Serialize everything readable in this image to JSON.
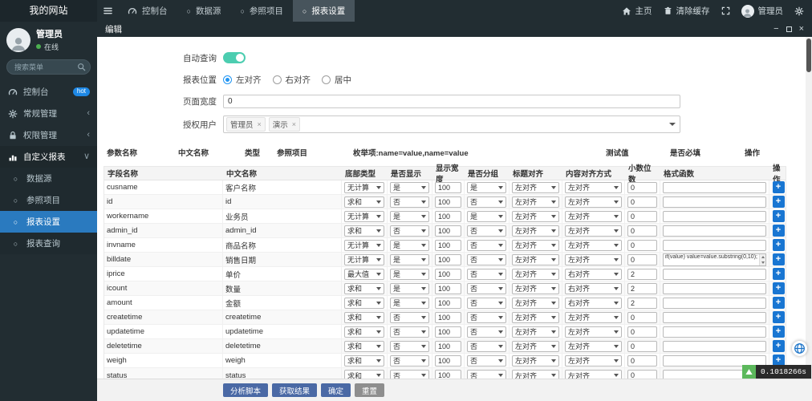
{
  "app": {
    "title": "我的网站"
  },
  "sidebar": {
    "user": {
      "name": "管理员",
      "status": "在线"
    },
    "search_placeholder": "搜索菜单",
    "menu": [
      {
        "id": "console",
        "label": "控制台",
        "icon": "dashboard-icon",
        "badge": "hot"
      },
      {
        "id": "general",
        "label": "常规管理",
        "icon": "gear-icon",
        "chevron": "left"
      },
      {
        "id": "auth",
        "label": "权限管理",
        "icon": "lock-icon",
        "chevron": "left"
      },
      {
        "id": "custom-report",
        "label": "自定义报表",
        "icon": "report-icon",
        "chevron": "down",
        "expanded": true,
        "children": [
          {
            "id": "datasource",
            "label": "数据源"
          },
          {
            "id": "reference",
            "label": "参照项目"
          },
          {
            "id": "report-setting",
            "label": "报表设置",
            "active": true
          },
          {
            "id": "report-query",
            "label": "报表查询"
          }
        ]
      }
    ]
  },
  "navbar": {
    "tabs": [
      {
        "id": "console",
        "label": "控制台",
        "icon": "dashboard-icon"
      },
      {
        "id": "datasource",
        "label": "数据源",
        "icon": "circle-icon"
      },
      {
        "id": "reference",
        "label": "参照项目",
        "icon": "circle-icon"
      },
      {
        "id": "report-setting",
        "label": "报表设置",
        "icon": "circle-icon",
        "active": true
      }
    ],
    "home": "主页",
    "clear_cache": "清除缓存",
    "user": "管理员"
  },
  "dialog": {
    "title": "编辑",
    "form": {
      "auto_query": {
        "label": "自动查询",
        "enabled": true
      },
      "position": {
        "label": "报表位置",
        "options": [
          "左对齐",
          "右对齐",
          "居中"
        ],
        "selected": "左对齐"
      },
      "page_width": {
        "label": "页面宽度",
        "value": "0"
      },
      "auth_users": {
        "label": "授权用户",
        "tags": [
          "管理员",
          "演示"
        ]
      }
    },
    "param_headers": [
      "参数名称",
      "中文名称",
      "类型",
      "参照项目",
      "枚举项:name=value,name=value",
      "测试值",
      "是否必填",
      "操作"
    ],
    "field_table": {
      "headers": [
        "字段名称",
        "中文名称",
        "底部类型",
        "是否显示",
        "显示宽度",
        "是否分组",
        "标题对齐",
        "内容对齐方式",
        "小数位数",
        "格式函数",
        "操作"
      ],
      "rows": [
        {
          "field": "cusname",
          "name": "客户名称",
          "calc": "无计算",
          "show": "是",
          "width": "100",
          "group": "是",
          "title_align": "左对齐",
          "content_align": "左对齐",
          "decimals": "0",
          "formatter": ""
        },
        {
          "field": "id",
          "name": "id",
          "calc": "求和",
          "show": "否",
          "width": "100",
          "group": "否",
          "title_align": "左对齐",
          "content_align": "左对齐",
          "decimals": "0",
          "formatter": ""
        },
        {
          "field": "workername",
          "name": "业务员",
          "calc": "无计算",
          "show": "是",
          "width": "100",
          "group": "是",
          "title_align": "左对齐",
          "content_align": "左对齐",
          "decimals": "0",
          "formatter": ""
        },
        {
          "field": "admin_id",
          "name": "admin_id",
          "calc": "求和",
          "show": "否",
          "width": "100",
          "group": "否",
          "title_align": "左对齐",
          "content_align": "左对齐",
          "decimals": "0",
          "formatter": ""
        },
        {
          "field": "invname",
          "name": "商品名称",
          "calc": "无计算",
          "show": "是",
          "width": "100",
          "group": "否",
          "title_align": "左对齐",
          "content_align": "左对齐",
          "decimals": "0",
          "formatter": ""
        },
        {
          "field": "billdate",
          "name": "销售日期",
          "calc": "无计算",
          "show": "是",
          "width": "100",
          "group": "否",
          "title_align": "左对齐",
          "content_align": "左对齐",
          "decimals": "0",
          "formatter": "if(value) value=value.substring(0,10);"
        },
        {
          "field": "iprice",
          "name": "单价",
          "calc": "最大值",
          "show": "是",
          "width": "100",
          "group": "否",
          "title_align": "左对齐",
          "content_align": "右对齐",
          "decimals": "2",
          "formatter": ""
        },
        {
          "field": "icount",
          "name": "数量",
          "calc": "求和",
          "show": "是",
          "width": "100",
          "group": "否",
          "title_align": "左对齐",
          "content_align": "右对齐",
          "decimals": "2",
          "formatter": ""
        },
        {
          "field": "amount",
          "name": "金额",
          "calc": "求和",
          "show": "是",
          "width": "100",
          "group": "否",
          "title_align": "左对齐",
          "content_align": "右对齐",
          "decimals": "2",
          "formatter": ""
        },
        {
          "field": "createtime",
          "name": "createtime",
          "calc": "求和",
          "show": "否",
          "width": "100",
          "group": "否",
          "title_align": "左对齐",
          "content_align": "左对齐",
          "decimals": "0",
          "formatter": ""
        },
        {
          "field": "updatetime",
          "name": "updatetime",
          "calc": "求和",
          "show": "否",
          "width": "100",
          "group": "否",
          "title_align": "左对齐",
          "content_align": "左对齐",
          "decimals": "0",
          "formatter": ""
        },
        {
          "field": "deletetime",
          "name": "deletetime",
          "calc": "求和",
          "show": "否",
          "width": "100",
          "group": "否",
          "title_align": "左对齐",
          "content_align": "左对齐",
          "decimals": "0",
          "formatter": ""
        },
        {
          "field": "weigh",
          "name": "weigh",
          "calc": "求和",
          "show": "否",
          "width": "100",
          "group": "否",
          "title_align": "左对齐",
          "content_align": "左对齐",
          "decimals": "0",
          "formatter": ""
        },
        {
          "field": "status",
          "name": "status",
          "calc": "求和",
          "show": "否",
          "width": "100",
          "group": "否",
          "title_align": "左对齐",
          "content_align": "左对齐",
          "decimals": "0",
          "formatter": ""
        }
      ]
    },
    "footer_buttons": [
      {
        "id": "analyze-script",
        "label": "分析脚本",
        "style": "primary"
      },
      {
        "id": "fetch-result",
        "label": "获取结果",
        "style": "primary"
      },
      {
        "id": "confirm",
        "label": "确定",
        "style": "primary"
      },
      {
        "id": "reset",
        "label": "重置",
        "style": "muted"
      }
    ]
  },
  "overlays": {
    "trace_time": "0.1018266s"
  },
  "colors": {
    "accent": "#2196f3",
    "active_blue": "#2a7abf",
    "toggle_teal": "#4ccdb0",
    "plus_blue": "#1976d2",
    "trace_green": "#5cb85c"
  }
}
